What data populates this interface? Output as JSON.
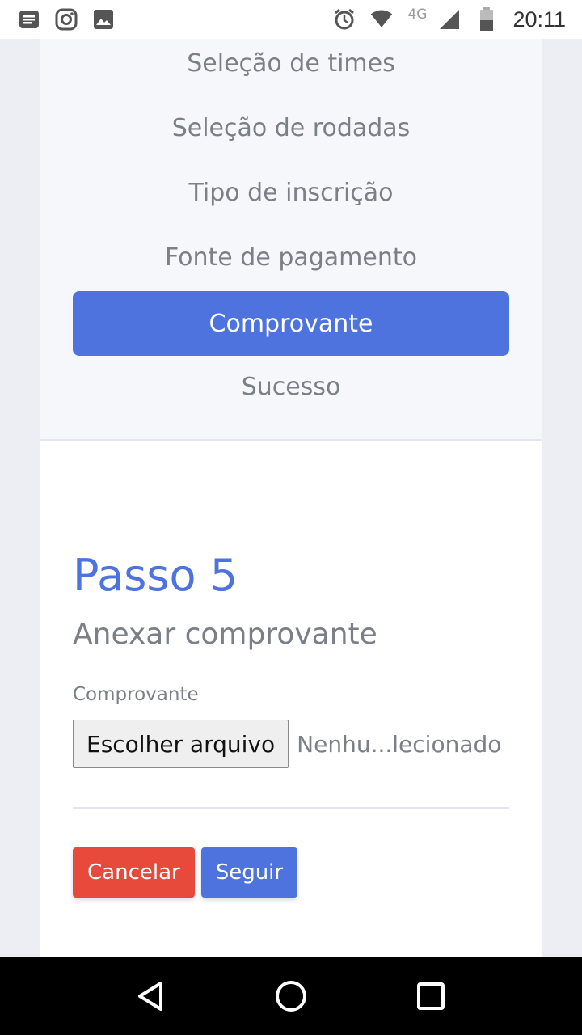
{
  "status_bar": {
    "network": "4G",
    "time": "20:11",
    "icons": [
      "news-icon",
      "instagram-icon",
      "image-icon",
      "alarm-icon",
      "wifi-icon",
      "signal-icon",
      "battery-icon"
    ]
  },
  "steps": [
    {
      "label": "Seleção de times",
      "active": false
    },
    {
      "label": "Seleção de rodadas",
      "active": false
    },
    {
      "label": "Tipo de inscrição",
      "active": false
    },
    {
      "label": "Fonte de pagamento",
      "active": false
    },
    {
      "label": "Comprovante",
      "active": true
    },
    {
      "label": "Sucesso",
      "active": false
    }
  ],
  "main": {
    "heading": "Passo 5",
    "subheading": "Anexar comprovante",
    "field_label": "Comprovante",
    "file_button": "Escolher arquivo",
    "file_status": "Nenhu...lecionado",
    "cancel_label": "Cancelar",
    "next_label": "Seguir"
  },
  "colors": {
    "primary": "#4e73df",
    "danger": "#e74a3b",
    "muted_text": "#7b7f86"
  },
  "nav_bar": {
    "icons": [
      "back-icon",
      "home-icon",
      "recents-icon"
    ]
  }
}
